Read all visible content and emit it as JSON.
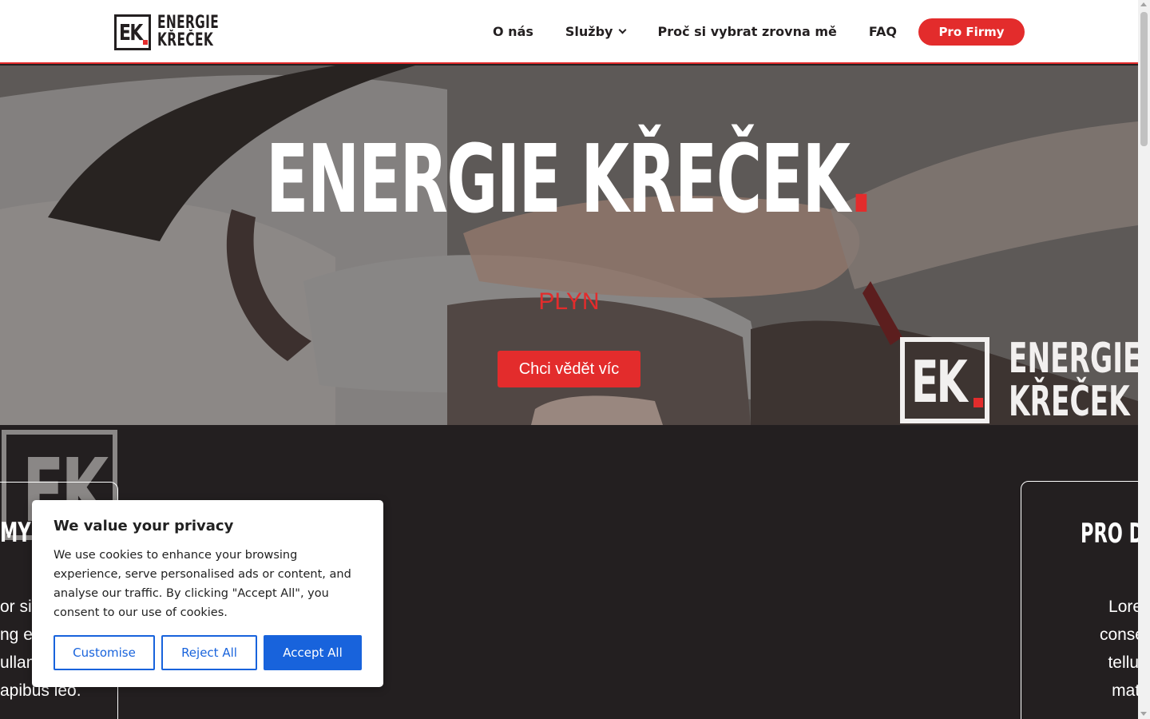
{
  "header": {
    "logo": {
      "mark": "EK",
      "line1": "ENERGIE",
      "line2": "KŘEČEK"
    },
    "nav": [
      {
        "label": "O nás"
      },
      {
        "label": "Služby"
      },
      {
        "label": "Proč si vybrat zrovna mě"
      },
      {
        "label": "FAQ"
      }
    ],
    "cta_label": "Pro Firmy"
  },
  "hero": {
    "title": "ENERGIE KŘEČEK",
    "title_dot": ".",
    "subtitle": "PLYN",
    "button_label": "Chci vědět víc",
    "watermark": {
      "mark": "EK",
      "line1": "ENERGIE",
      "line2": "KŘEČEK"
    }
  },
  "section": {
    "watermark_mark": "EK",
    "left_card": {
      "title": "MY",
      "lines": [
        "or sit",
        "ng el",
        "ullam",
        "apibus leo."
      ]
    },
    "right_card": {
      "title": "PRO D",
      "lines": [
        "Lorem ipsu",
        "consectetur a",
        "tellus, luctu",
        "mattis, pul"
      ]
    }
  },
  "cookie": {
    "title": "We value your privacy",
    "text": "We use cookies to enhance your browsing experience, serve personalised ads or content, and analyse our traffic. By clicking \"Accept All\", you consent to our use of cookies.",
    "customise_label": "Customise",
    "reject_label": "Reject All",
    "accept_label": "Accept All"
  },
  "colors": {
    "accent": "#e32c2c",
    "dark": "#231f20",
    "cookie_blue": "#1863dc"
  },
  "icons": {
    "services_dropdown": "chevron-down-icon"
  }
}
